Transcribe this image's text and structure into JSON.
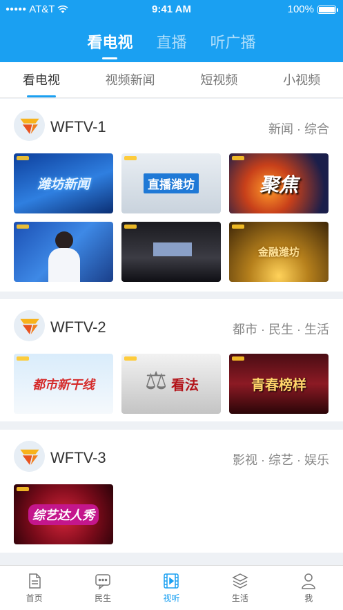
{
  "status_bar": {
    "carrier": "AT&T",
    "time": "9:41 AM",
    "battery": "100%"
  },
  "top_tabs": [
    {
      "label": "看电视"
    },
    {
      "label": "直播"
    },
    {
      "label": "听广播"
    }
  ],
  "sub_tabs": [
    {
      "label": "看电视"
    },
    {
      "label": "视频新闻"
    },
    {
      "label": "短视频"
    },
    {
      "label": "小视频"
    }
  ],
  "channels": [
    {
      "name": "WFTV-1",
      "tags": "新闻 · 综合",
      "thumbs": [
        {
          "label": "潍坊新闻"
        },
        {
          "label": "直播潍坊"
        },
        {
          "label": "聚焦"
        },
        {
          "label": ""
        },
        {
          "label": ""
        },
        {
          "label": "金融潍坊"
        }
      ]
    },
    {
      "name": "WFTV-2",
      "tags": "都市 · 民生 · 生活",
      "thumbs": [
        {
          "label": "都市新干线"
        },
        {
          "label": "看法"
        },
        {
          "label": "青春榜样"
        }
      ]
    },
    {
      "name": "WFTV-3",
      "tags": "影视 · 综艺 · 娱乐",
      "thumbs": [
        {
          "label": "综艺达人秀"
        }
      ]
    }
  ],
  "bottom_nav": [
    {
      "label": "首页",
      "icon": "document-icon"
    },
    {
      "label": "民生",
      "icon": "chat-icon"
    },
    {
      "label": "视听",
      "icon": "film-icon"
    },
    {
      "label": "生活",
      "icon": "layers-icon"
    },
    {
      "label": "我",
      "icon": "user-icon"
    }
  ],
  "colors": {
    "accent": "#1aa0f2"
  }
}
